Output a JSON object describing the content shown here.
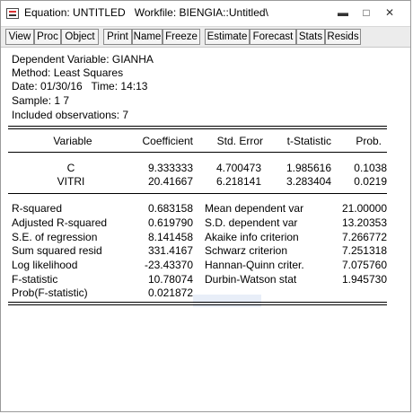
{
  "window": {
    "title": "Equation: UNTITLED   Workfile: BIENGIA::Untitled\\",
    "minimize_glyph": "▬",
    "restore_glyph": "□",
    "close_glyph": "✕"
  },
  "toolbar": {
    "buttons": [
      "View",
      "Proc",
      "Object",
      "Print",
      "Name",
      "Freeze",
      "Estimate",
      "Forecast",
      "Stats",
      "Resids"
    ]
  },
  "header": {
    "dependent": "Dependent Variable: GIANHA",
    "method": "Method: Least Squares",
    "date": "Date: 01/30/16   Time: 14:13",
    "sample": "Sample: 1 7",
    "observations": "Included observations: 7"
  },
  "coef_table": {
    "headers": [
      "Variable",
      "Coefficient",
      "Std. Error",
      "t-Statistic",
      "Prob."
    ],
    "rows": [
      [
        "C",
        "9.333333",
        "4.700473",
        "1.985616",
        "0.1038"
      ],
      [
        "VITRI",
        "20.41667",
        "6.218141",
        "3.283404",
        "0.0219"
      ]
    ]
  },
  "stats": {
    "left": [
      [
        "R-squared",
        "0.683158"
      ],
      [
        "Adjusted R-squared",
        "0.619790"
      ],
      [
        "S.E. of regression",
        "8.141458"
      ],
      [
        "Sum squared resid",
        "331.4167"
      ],
      [
        "Log likelihood",
        "-23.43370"
      ],
      [
        "F-statistic",
        "10.78074"
      ],
      [
        "Prob(F-statistic)",
        "0.021872"
      ]
    ],
    "right": [
      [
        "Mean dependent var",
        "21.00000"
      ],
      [
        "S.D. dependent var",
        "13.20353"
      ],
      [
        "Akaike info criterion",
        "7.266772"
      ],
      [
        "Schwarz criterion",
        "7.251318"
      ],
      [
        "Hannan-Quinn criter.",
        "7.075760"
      ],
      [
        "Durbin-Watson stat",
        "1.945730"
      ]
    ]
  }
}
